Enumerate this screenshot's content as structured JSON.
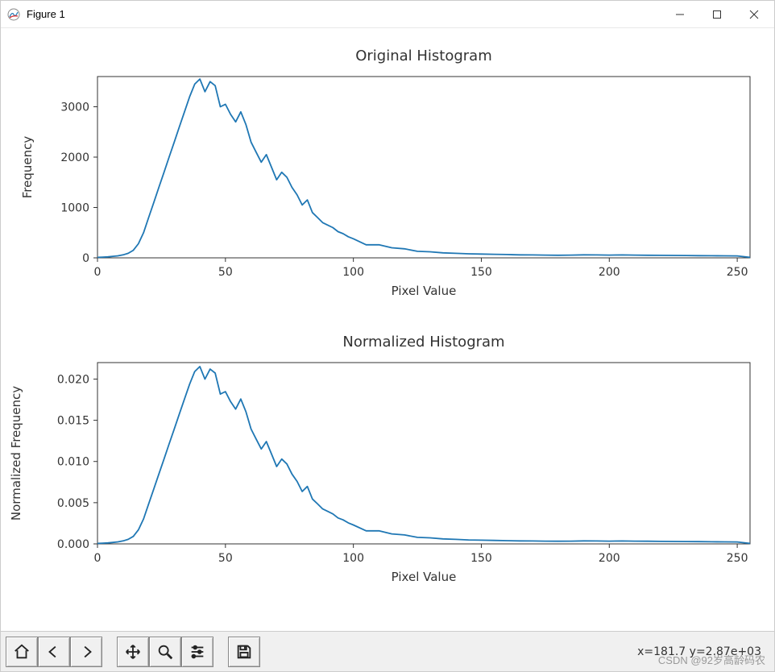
{
  "window": {
    "title": "Figure 1"
  },
  "toolbar": {
    "buttons": {
      "home": "Home",
      "back": "Back",
      "forward": "Forward",
      "pan": "Pan",
      "zoom": "Zoom",
      "configure": "Configure subplots",
      "save": "Save"
    },
    "coord_readout": "x=181.7 y=2.87e+03"
  },
  "watermark": "CSDN @92岁高龄码农",
  "chart_data": [
    {
      "type": "line",
      "title": "Original Histogram",
      "xlabel": "Pixel Value",
      "ylabel": "Frequency",
      "xlim": [
        0,
        255
      ],
      "ylim": [
        0,
        3600
      ],
      "xticks": [
        0,
        50,
        100,
        150,
        200,
        250
      ],
      "yticks": [
        0,
        1000,
        2000,
        3000
      ],
      "x": [
        0,
        2,
        4,
        6,
        8,
        10,
        12,
        14,
        16,
        18,
        20,
        22,
        24,
        26,
        28,
        30,
        32,
        34,
        36,
        38,
        40,
        42,
        44,
        46,
        48,
        50,
        52,
        54,
        56,
        58,
        60,
        62,
        64,
        66,
        68,
        70,
        72,
        74,
        76,
        78,
        80,
        82,
        84,
        86,
        88,
        90,
        92,
        94,
        96,
        98,
        100,
        105,
        110,
        115,
        120,
        125,
        130,
        135,
        140,
        145,
        150,
        155,
        160,
        165,
        170,
        175,
        180,
        185,
        190,
        195,
        200,
        205,
        210,
        215,
        220,
        225,
        230,
        235,
        240,
        245,
        250,
        255
      ],
      "y": [
        10,
        15,
        20,
        30,
        40,
        60,
        90,
        150,
        280,
        500,
        800,
        1100,
        1400,
        1700,
        2000,
        2300,
        2600,
        2900,
        3200,
        3450,
        3550,
        3300,
        3500,
        3420,
        3000,
        3050,
        2850,
        2700,
        2900,
        2650,
        2300,
        2100,
        1900,
        2050,
        1800,
        1550,
        1700,
        1600,
        1400,
        1250,
        1050,
        1150,
        900,
        800,
        700,
        650,
        600,
        520,
        480,
        420,
        380,
        260,
        260,
        200,
        180,
        130,
        120,
        100,
        90,
        80,
        75,
        70,
        65,
        60,
        58,
        55,
        52,
        55,
        60,
        58,
        55,
        58,
        55,
        52,
        50,
        48,
        46,
        44,
        42,
        40,
        38,
        10
      ]
    },
    {
      "type": "line",
      "title": "Normalized Histogram",
      "xlabel": "Pixel Value",
      "ylabel": "Normalized Frequency",
      "xlim": [
        0,
        255
      ],
      "ylim": [
        0,
        0.022
      ],
      "xticks": [
        0,
        50,
        100,
        150,
        200,
        250
      ],
      "yticks": [
        0.0,
        0.005,
        0.01,
        0.015,
        0.02
      ],
      "ytick_labels": [
        "0.000",
        "0.005",
        "0.010",
        "0.015",
        "0.020"
      ],
      "x": [
        0,
        2,
        4,
        6,
        8,
        10,
        12,
        14,
        16,
        18,
        20,
        22,
        24,
        26,
        28,
        30,
        32,
        34,
        36,
        38,
        40,
        42,
        44,
        46,
        48,
        50,
        52,
        54,
        56,
        58,
        60,
        62,
        64,
        66,
        68,
        70,
        72,
        74,
        76,
        78,
        80,
        82,
        84,
        86,
        88,
        90,
        92,
        94,
        96,
        98,
        100,
        105,
        110,
        115,
        120,
        125,
        130,
        135,
        140,
        145,
        150,
        155,
        160,
        165,
        170,
        175,
        180,
        185,
        190,
        195,
        200,
        205,
        210,
        215,
        220,
        225,
        230,
        235,
        240,
        245,
        250,
        255
      ],
      "y": [
        6e-05,
        9e-05,
        0.00012,
        0.00018,
        0.00024,
        0.00036,
        0.00055,
        0.00091,
        0.0017,
        0.00303,
        0.00485,
        0.00667,
        0.00848,
        0.0103,
        0.01212,
        0.01394,
        0.01576,
        0.01758,
        0.01939,
        0.02091,
        0.02152,
        0.02,
        0.02121,
        0.02073,
        0.01818,
        0.01848,
        0.01727,
        0.01636,
        0.01758,
        0.01606,
        0.01394,
        0.01273,
        0.01152,
        0.01242,
        0.01091,
        0.00939,
        0.0103,
        0.0097,
        0.00848,
        0.00758,
        0.00636,
        0.00697,
        0.00545,
        0.00485,
        0.00424,
        0.00394,
        0.00364,
        0.00315,
        0.00291,
        0.00255,
        0.0023,
        0.00158,
        0.00158,
        0.00121,
        0.00109,
        0.00079,
        0.00073,
        0.00061,
        0.00055,
        0.00048,
        0.00045,
        0.00042,
        0.00039,
        0.00036,
        0.00035,
        0.00033,
        0.00032,
        0.00033,
        0.00036,
        0.00035,
        0.00033,
        0.00035,
        0.00033,
        0.00032,
        0.0003,
        0.00029,
        0.00028,
        0.00027,
        0.00025,
        0.00024,
        0.00023,
        6e-05
      ]
    }
  ]
}
